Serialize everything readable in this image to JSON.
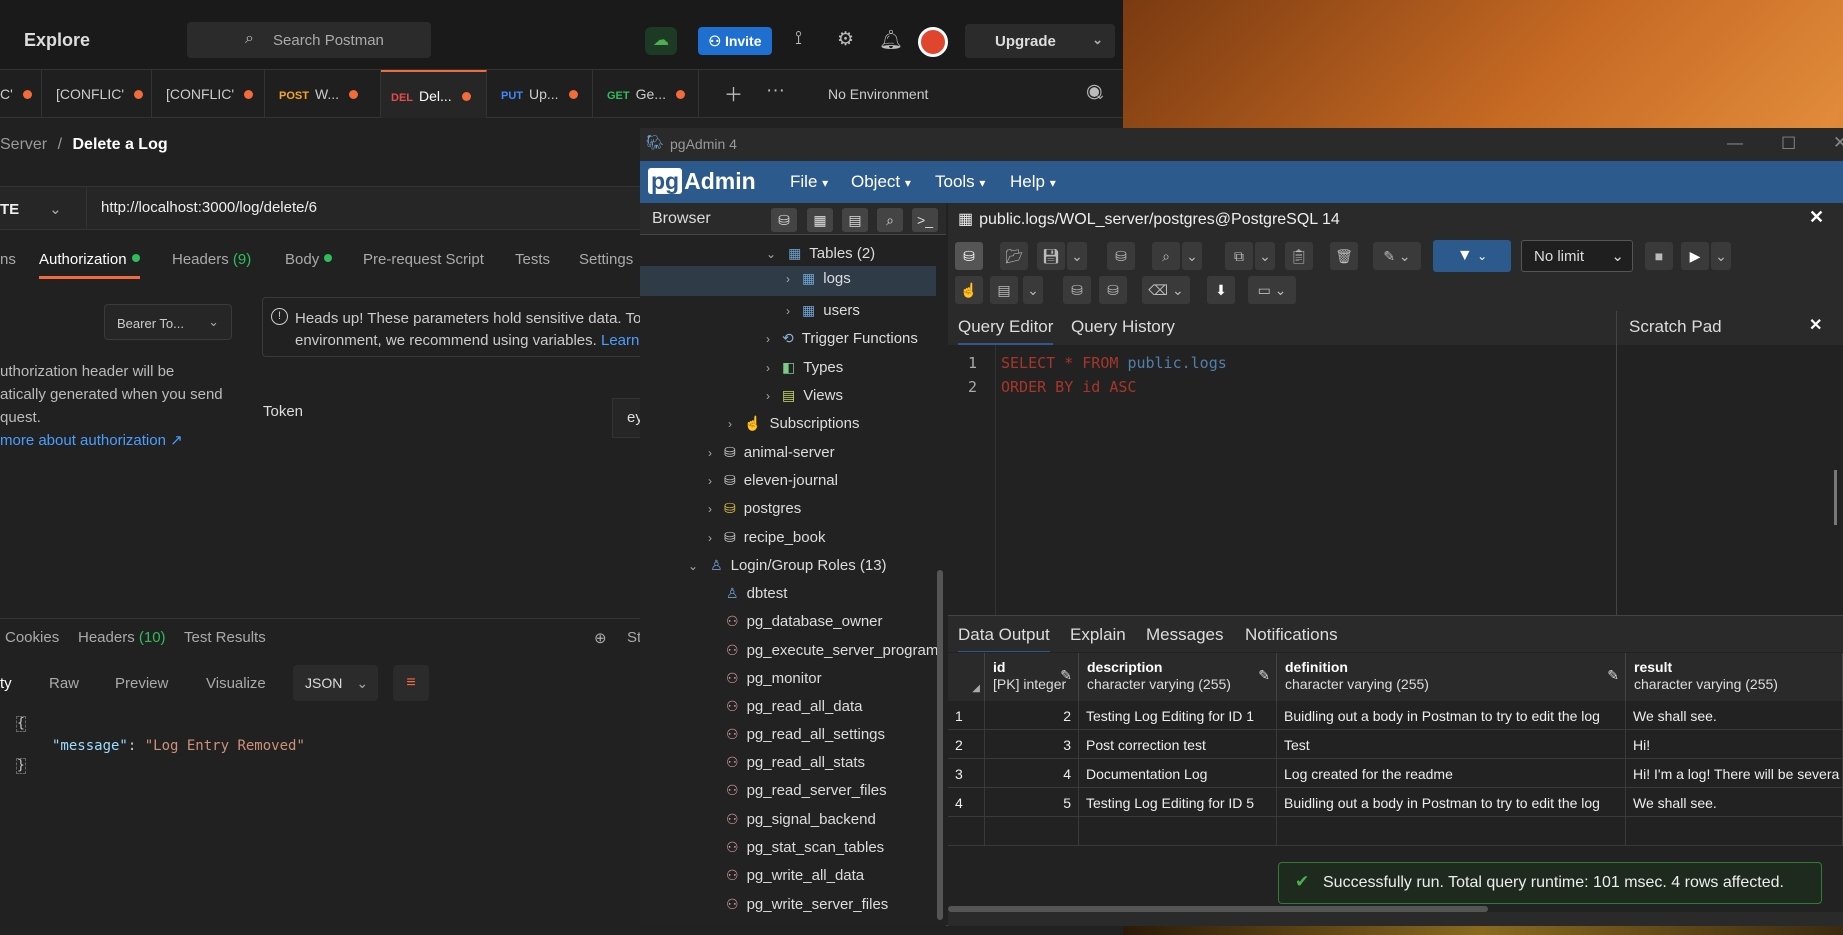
{
  "postman": {
    "explore": "Explore",
    "search_placeholder": "Search Postman",
    "invite": "Invite",
    "upgrade": "Upgrade",
    "tabs": [
      {
        "method": "",
        "label": "C'"
      },
      {
        "method": "",
        "label": "[CONFLIC'"
      },
      {
        "method": "",
        "label": "[CONFLIC'"
      },
      {
        "method": "POST",
        "label": "W..."
      },
      {
        "method": "DEL",
        "label": "Del..."
      },
      {
        "method": "PUT",
        "label": "Up..."
      },
      {
        "method": "GET",
        "label": "Ge..."
      }
    ],
    "environment": "No Environment",
    "breadcrumb_parent": "Server",
    "breadcrumb_sep": "/",
    "breadcrumb_current": "Delete a Log",
    "method": "TE",
    "url": "http://localhost:3000/log/delete/6",
    "req_tabs": {
      "params": "ns",
      "auth": "Authorization",
      "headers": "Headers",
      "headers_count": "(9)",
      "body": "Body",
      "prerequest": "Pre-request Script",
      "tests": "Tests",
      "settings": "Settings"
    },
    "auth_type": "Bearer To...",
    "note_line1": "Heads up! These parameters hold sensitive data. To",
    "note_line2": "environment, we recommend using variables.",
    "note_link": "Learn",
    "auth_text_1": "uthorization header will be",
    "auth_text_2": "atically generated when you send",
    "auth_text_3": "quest.",
    "auth_link": "more about authorization ↗",
    "token_label": "Token",
    "token_value": "ey",
    "res_tabs": {
      "cookies": "Cookies",
      "headers": "Headers",
      "headers_count": "(10)",
      "tests": "Test Results",
      "status": "St"
    },
    "view_tabs": {
      "pretty": "ty",
      "raw": "Raw",
      "preview": "Preview",
      "visualize": "Visualize",
      "format": "JSON"
    },
    "response_key": "\"message\"",
    "response_colon": ":",
    "response_value": "\"Log Entry Removed\""
  },
  "pgadmin": {
    "window_title": "pgAdmin 4",
    "logo_box": "pg",
    "logo_text": "Admin",
    "menu": [
      "File",
      "Object",
      "Tools",
      "Help"
    ],
    "browser_title": "Browser",
    "tree": {
      "tables": "Tables (2)",
      "logs": "logs",
      "users": "users",
      "trigger_functions": "Trigger Functions",
      "types": "Types",
      "views": "Views",
      "subscriptions": "Subscriptions",
      "animal_server": "animal-server",
      "eleven_journal": "eleven-journal",
      "postgres": "postgres",
      "recipe_book": "recipe_book",
      "login_roles": "Login/Group Roles (13)",
      "roles": [
        "dbtest",
        "pg_database_owner",
        "pg_execute_server_program",
        "pg_monitor",
        "pg_read_all_data",
        "pg_read_all_settings",
        "pg_read_all_stats",
        "pg_read_server_files",
        "pg_signal_backend",
        "pg_stat_scan_tables",
        "pg_write_all_data",
        "pg_write_server_files"
      ]
    },
    "query_title": "public.logs/WOL_server/postgres@PostgreSQL 14",
    "limit": "No limit",
    "tabs": {
      "editor": "Query Editor",
      "history": "Query History",
      "scratch": "Scratch Pad"
    },
    "sql": {
      "line1_kw": "SELECT * FROM",
      "line1_tbl": "public.logs",
      "line2": "ORDER BY id ASC"
    },
    "output_tabs": {
      "data": "Data Output",
      "explain": "Explain",
      "messages": "Messages",
      "notifications": "Notifications"
    },
    "columns": [
      {
        "name": "id",
        "type": "[PK] integer"
      },
      {
        "name": "description",
        "type": "character varying (255)"
      },
      {
        "name": "definition",
        "type": "character varying (255)"
      },
      {
        "name": "result",
        "type": "character varying (255)"
      }
    ],
    "rows": [
      {
        "n": "1",
        "id": "2",
        "description": "Testing Log Editing for ID 1",
        "definition": "Buidling out a body in Postman to try to edit the log",
        "result": "We shall see."
      },
      {
        "n": "2",
        "id": "3",
        "description": "Post correction test",
        "definition": "Test",
        "result": "Hi!"
      },
      {
        "n": "3",
        "id": "4",
        "description": "Documentation Log",
        "definition": "Log created for the readme",
        "result": "Hi! I'm a log! There will be severa"
      },
      {
        "n": "4",
        "id": "5",
        "description": "Testing Log Editing for ID 5",
        "definition": "Buidling out a body in Postman to try to edit the log",
        "result": "We shall see."
      }
    ],
    "toast": "Successfully run. Total query runtime: 101 msec. 4 rows affected."
  }
}
